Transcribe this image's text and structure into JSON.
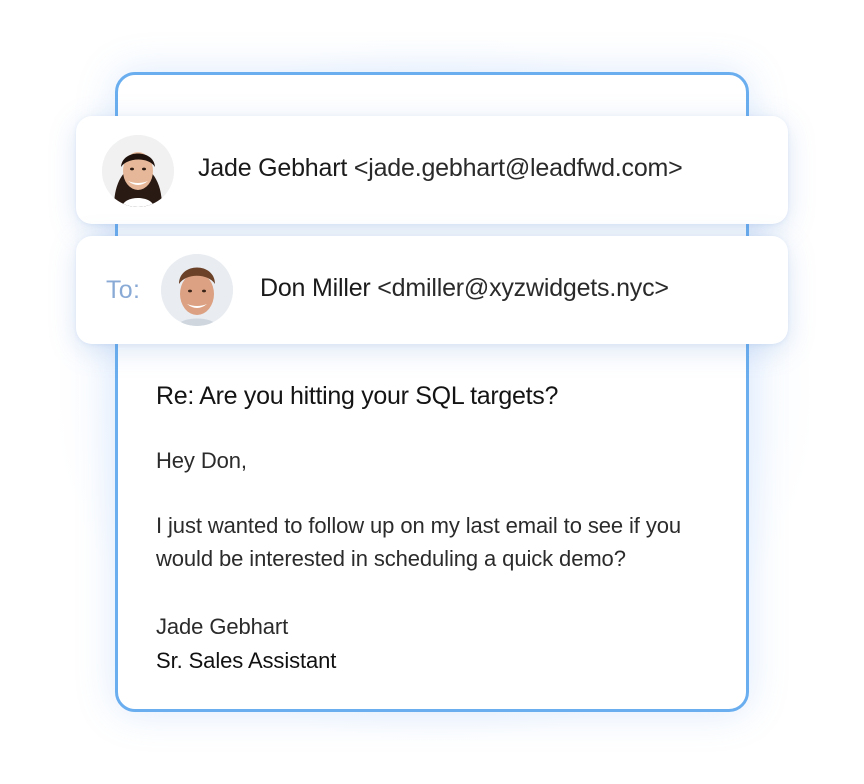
{
  "sender": {
    "name": "Jade Gebhart",
    "email": "<jade.gebhart@leadfwd.com>"
  },
  "recipient": {
    "to_label": "To:",
    "name": "Don Miller",
    "email": "<dmiller@xyzwidgets.nyc>"
  },
  "message": {
    "subject": "Re: Are you hitting your SQL targets?",
    "greeting": "Hey Don,",
    "body_line_1": "I just wanted to follow up on my last email to see if you",
    "body_line_2": "would be interested in scheduling a quick demo?",
    "signature_name": "Jade Gebhart",
    "signature_title": "Sr. Sales Assistant"
  },
  "colors": {
    "card_border": "#6aaeef",
    "to_label": "#8aaad6"
  }
}
